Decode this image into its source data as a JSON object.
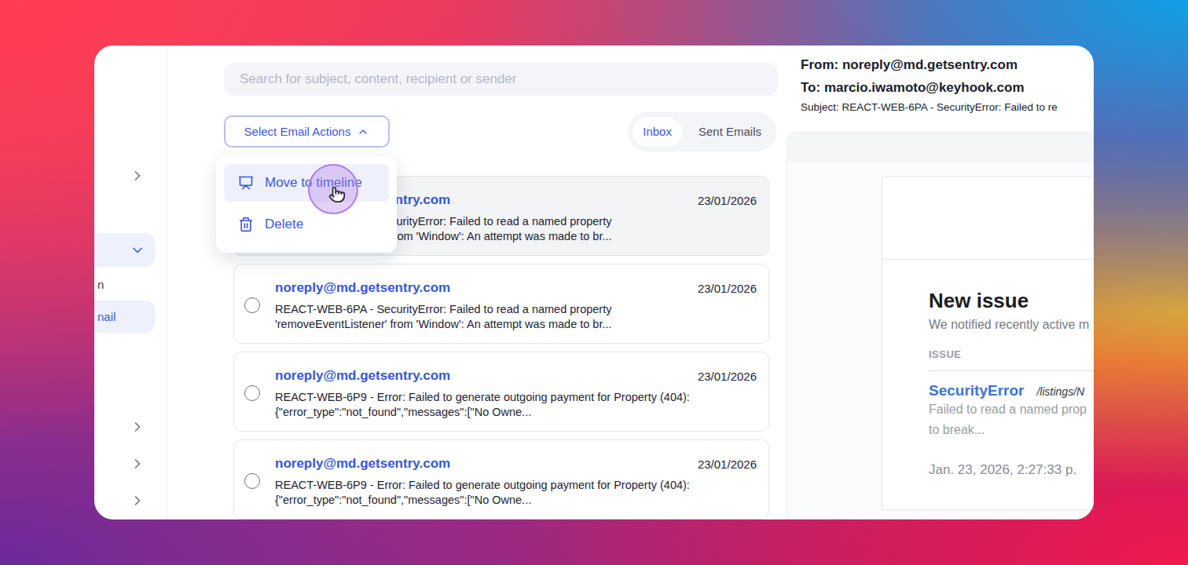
{
  "sidebar": {
    "items": [
      {
        "kind": "group",
        "expanded": false,
        "selected": false
      },
      {
        "kind": "group",
        "expanded": true,
        "selected": true
      },
      {
        "kind": "link",
        "label": "n",
        "selected": false
      },
      {
        "kind": "link",
        "label": "nail",
        "selected": true
      },
      {
        "kind": "group",
        "expanded": false,
        "selected": false
      },
      {
        "kind": "group",
        "expanded": false,
        "selected": false
      },
      {
        "kind": "group",
        "expanded": false,
        "selected": false
      }
    ]
  },
  "search": {
    "placeholder": "Search for subject, content, recipient or sender"
  },
  "actions": {
    "label": "Select Email Actions",
    "expanded": true,
    "menu": [
      {
        "label": "Move to timeline",
        "kind": "timeline",
        "highlighted": true
      },
      {
        "label": "Delete",
        "kind": "delete",
        "highlighted": false
      }
    ]
  },
  "tabs": [
    {
      "label": "Inbox",
      "selected": true
    },
    {
      "label": "Sent Emails",
      "selected": false
    }
  ],
  "emails": [
    {
      "sender": "noreply@md.getsentry.com",
      "date": "23/01/2026",
      "lines": [
        "REACT-WEB-6PA - SecurityError: Failed to read a named property",
        "'removeEventListener' from 'Window': An attempt was made to br..."
      ],
      "selected": true
    },
    {
      "sender": "noreply@md.getsentry.com",
      "date": "23/01/2026",
      "lines": [
        "REACT-WEB-6PA - SecurityError: Failed to read a named property",
        "'removeEventListener' from 'Window': An attempt was made to br..."
      ],
      "selected": false
    },
    {
      "sender": "noreply@md.getsentry.com",
      "date": "23/01/2026",
      "lines": [
        "REACT-WEB-6P9 - Error: Failed to generate outgoing payment for Property (404):",
        "{\"error_type\":\"not_found\",\"messages\":[\"No Owne..."
      ],
      "selected": false
    },
    {
      "sender": "noreply@md.getsentry.com",
      "date": "23/01/2026",
      "lines": [
        "REACT-WEB-6P9 - Error: Failed to generate outgoing payment for Property (404):",
        "{\"error_type\":\"not_found\",\"messages\":[\"No Owne..."
      ],
      "selected": false
    }
  ],
  "viewer": {
    "from": "From: noreply@md.getsentry.com",
    "to": "To: marcio.iwamoto@keyhook.com",
    "subject": "Subject: REACT-WEB-6PA - SecurityError: Failed to re",
    "message": {
      "title": "New issue",
      "intro": "We notified recently active m",
      "section": "ISSUE",
      "issue_type": "SecurityError",
      "issue_path": "/listings/N",
      "issue_detail": [
        "Failed to read a named prop",
        "to break..."
      ],
      "timestamp": "Jan. 23, 2026, 2:27:33 p."
    }
  }
}
